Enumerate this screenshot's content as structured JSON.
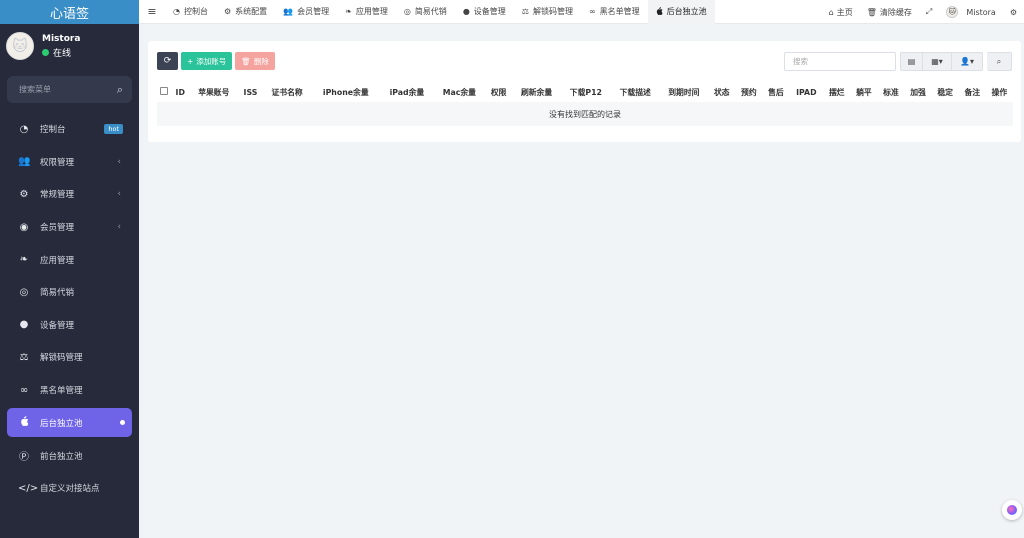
{
  "app": {
    "logo_text": "心语签"
  },
  "user": {
    "name": "Mistora",
    "status": "在线",
    "avatar_emoji": "🐱"
  },
  "sidebar": {
    "search_placeholder": "搜索菜单",
    "items": [
      {
        "label": "控制台",
        "icon": "dashboard-icon",
        "glyph": "◔",
        "badge": "hot"
      },
      {
        "label": "权限管理",
        "icon": "users-icon",
        "glyph": "👥",
        "chev": "‹"
      },
      {
        "label": "常规管理",
        "icon": "cogs-icon",
        "glyph": "⚙",
        "chev": "‹"
      },
      {
        "label": "会员管理",
        "icon": "user-circle-icon",
        "glyph": "◉",
        "chev": "‹"
      },
      {
        "label": "应用管理",
        "icon": "leaf-icon",
        "glyph": "❧"
      },
      {
        "label": "简易代销",
        "icon": "spotify-icon",
        "glyph": "◎"
      },
      {
        "label": "设备管理",
        "icon": "circle-icon",
        "glyph": "●"
      },
      {
        "label": "解锁码管理",
        "icon": "balance-scale-icon",
        "glyph": "⚖"
      },
      {
        "label": "黑名单管理",
        "icon": "bicycle-icon",
        "glyph": "∞"
      },
      {
        "label": "后台独立池",
        "icon": "apple-icon",
        "glyph": ""
      },
      {
        "label": "前台独立池",
        "icon": "product-hunt-icon",
        "glyph": "Ⓟ"
      },
      {
        "label": "自定义对接站点",
        "icon": "code-icon",
        "glyph": "</>"
      }
    ]
  },
  "topbar": {
    "tabs": [
      {
        "label": "控制台",
        "glyph": "◔"
      },
      {
        "label": "系统配置",
        "glyph": "⚙"
      },
      {
        "label": "会员管理",
        "glyph": "👥"
      },
      {
        "label": "应用管理",
        "glyph": "❧"
      },
      {
        "label": "简易代销",
        "glyph": "◎"
      },
      {
        "label": "设备管理",
        "glyph": "●"
      },
      {
        "label": "解锁码管理",
        "glyph": "⚖"
      },
      {
        "label": "黑名单管理",
        "glyph": "∞"
      },
      {
        "label": "后台独立池",
        "glyph": ""
      }
    ],
    "home": "主页",
    "clear_cache": "清除缓存",
    "username": "Mistora"
  },
  "toolbar": {
    "add_label": "添加账号",
    "delete_label": "删除",
    "search_placeholder": "搜索"
  },
  "table": {
    "columns": [
      "ID",
      "苹果账号",
      "ISS",
      "证书名称",
      "iPhone余量",
      "iPad余量",
      "Mac余量",
      "权限",
      "刷新余量",
      "下载P12",
      "下载描述",
      "到期时间",
      "状态",
      "预约",
      "售后",
      "IPAD",
      "摆烂",
      "躺平",
      "标准",
      "加强",
      "稳定",
      "备注",
      "操作"
    ],
    "empty_text": "没有找到匹配的记录"
  },
  "colors": {
    "sidebar_bg": "#262a3b",
    "accent": "#6f63e8",
    "logo_bg": "#3a8ec7",
    "add_btn": "#2bc39a",
    "delete_btn": "#f4a39f"
  }
}
